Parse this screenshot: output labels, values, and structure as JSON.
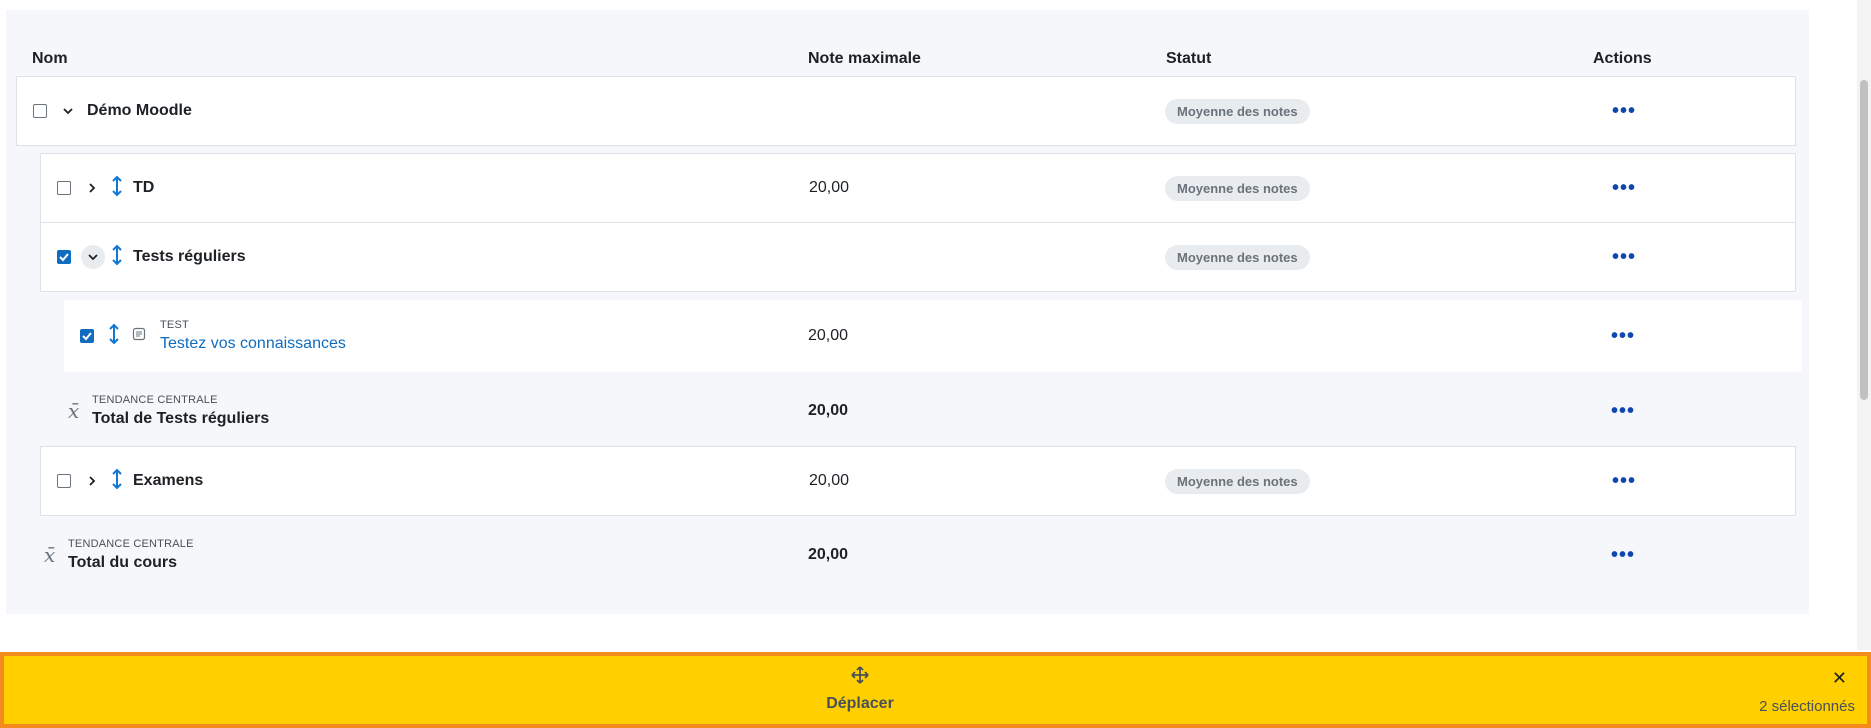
{
  "table": {
    "headers": {
      "name": "Nom",
      "max_grade": "Note maximale",
      "status": "Statut",
      "actions": "Actions"
    },
    "rows": [
      {
        "type": "category",
        "name": "Démo Moodle",
        "max_grade": "",
        "status": "Moyenne des notes",
        "checked": false,
        "expanded": true
      },
      {
        "type": "category",
        "name": "TD",
        "max_grade": "20,00",
        "status": "Moyenne des notes",
        "checked": false,
        "expanded": false
      },
      {
        "type": "category",
        "name": "Tests réguliers",
        "max_grade": "",
        "status": "Moyenne des notes",
        "checked": true,
        "expanded": true
      },
      {
        "type": "item",
        "kind": "TEST",
        "name": "Testez vos connaissances",
        "max_grade": "20,00",
        "checked": true
      },
      {
        "type": "total",
        "kind": "TENDANCE CENTRALE",
        "name": "Total de Tests réguliers",
        "max_grade": "20,00"
      },
      {
        "type": "category",
        "name": "Examens",
        "max_grade": "20,00",
        "status": "Moyenne des notes",
        "checked": false,
        "expanded": false
      },
      {
        "type": "total",
        "kind": "TENDANCE CENTRALE",
        "name": "Total du cours",
        "max_grade": "20,00"
      }
    ],
    "actions_glyph": "•••"
  },
  "footer": {
    "move_label": "Déplacer",
    "selected_count": "2 sélectionnés",
    "close_glyph": "✕"
  },
  "colors": {
    "footer_bg": "#ffcf00",
    "footer_border": "#f48b1f",
    "accent": "#0f6cbf",
    "drag_icon": "#1177d1"
  }
}
